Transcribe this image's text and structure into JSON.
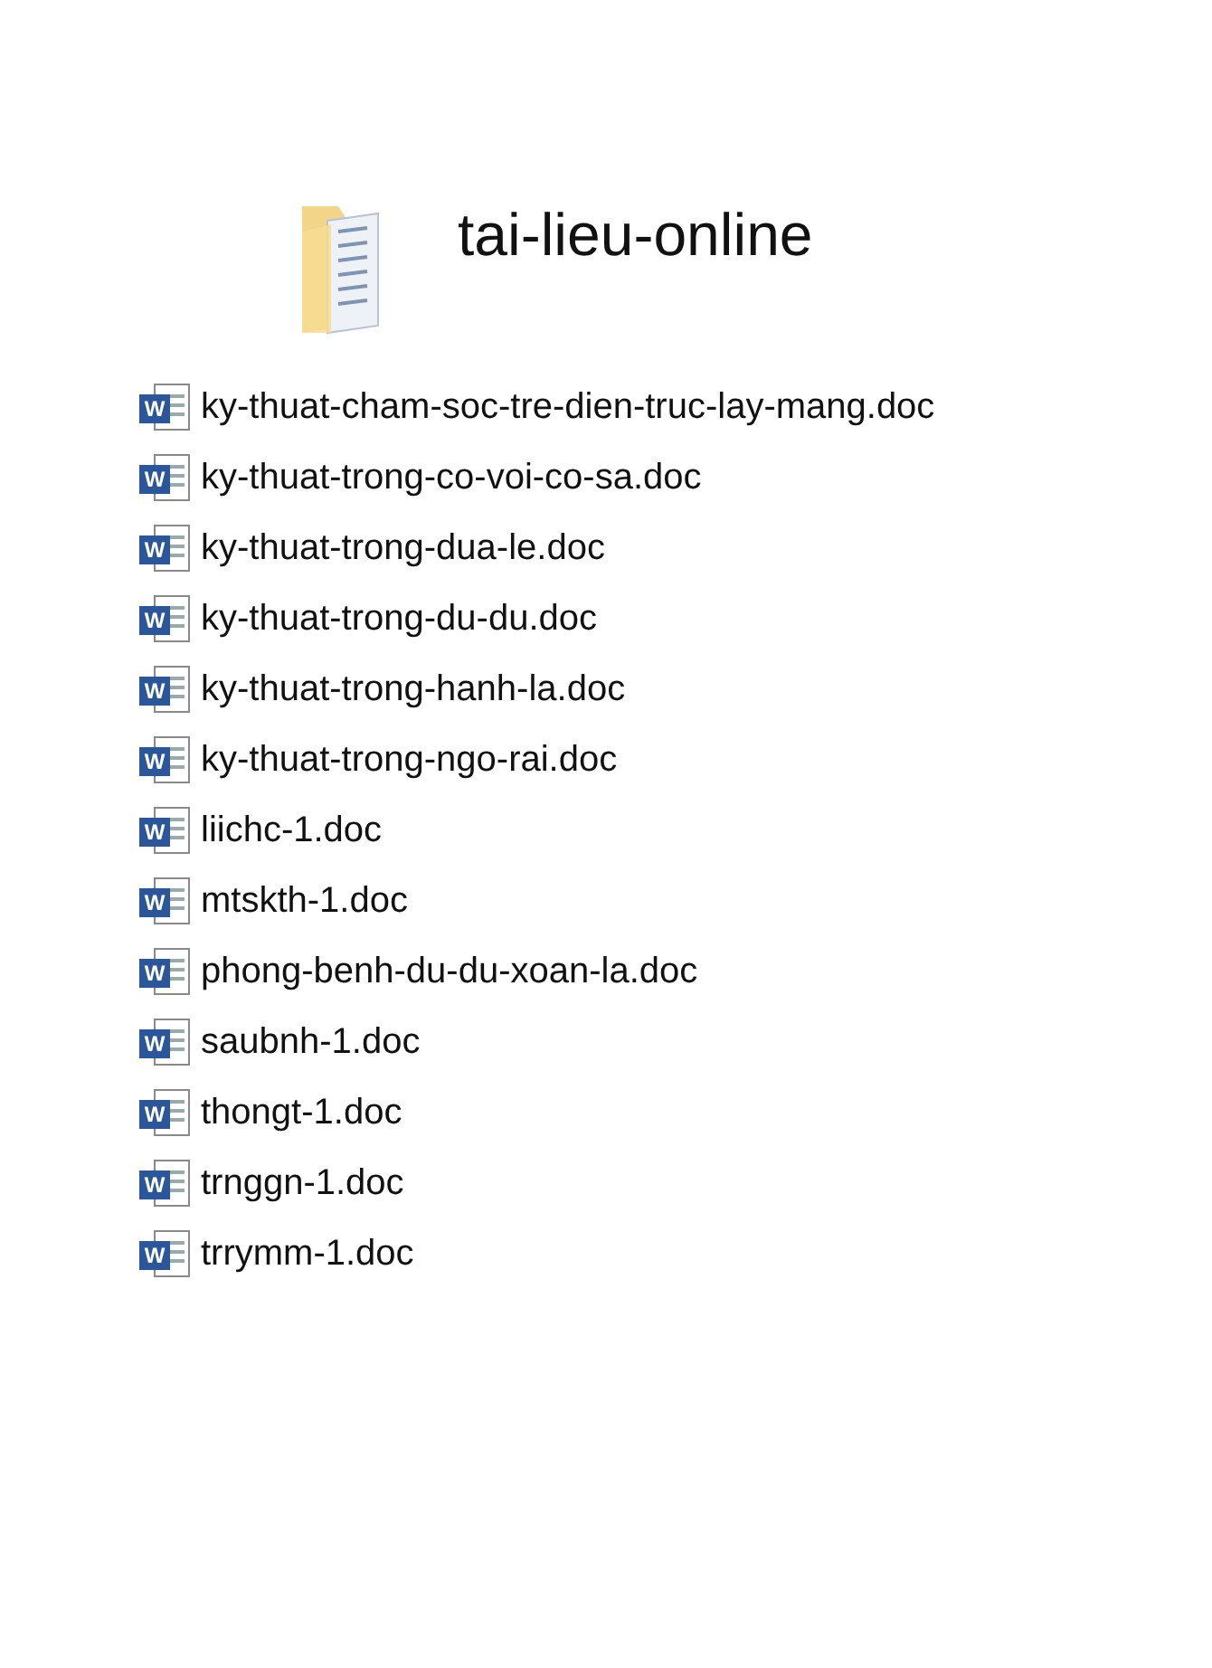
{
  "folder": {
    "title": "tai-lieu-online"
  },
  "files": [
    {
      "icon_letter": "W",
      "name": "ky-thuat-cham-soc-tre-dien-truc-lay-mang.doc"
    },
    {
      "icon_letter": "W",
      "name": "ky-thuat-trong-co-voi-co-sa.doc"
    },
    {
      "icon_letter": "W",
      "name": "ky-thuat-trong-dua-le.doc"
    },
    {
      "icon_letter": "W",
      "name": "ky-thuat-trong-du-du.doc"
    },
    {
      "icon_letter": "W",
      "name": "ky-thuat-trong-hanh-la.doc"
    },
    {
      "icon_letter": "W",
      "name": "ky-thuat-trong-ngo-rai.doc"
    },
    {
      "icon_letter": "W",
      "name": "liichc-1.doc"
    },
    {
      "icon_letter": "W",
      "name": "mtskth-1.doc"
    },
    {
      "icon_letter": "W",
      "name": "phong-benh-du-du-xoan-la.doc"
    },
    {
      "icon_letter": "W",
      "name": "saubnh-1.doc"
    },
    {
      "icon_letter": "W",
      "name": "thongt-1.doc"
    },
    {
      "icon_letter": "W",
      "name": "trnggn-1.doc"
    },
    {
      "icon_letter": "W",
      "name": "trrymm-1.doc"
    }
  ]
}
